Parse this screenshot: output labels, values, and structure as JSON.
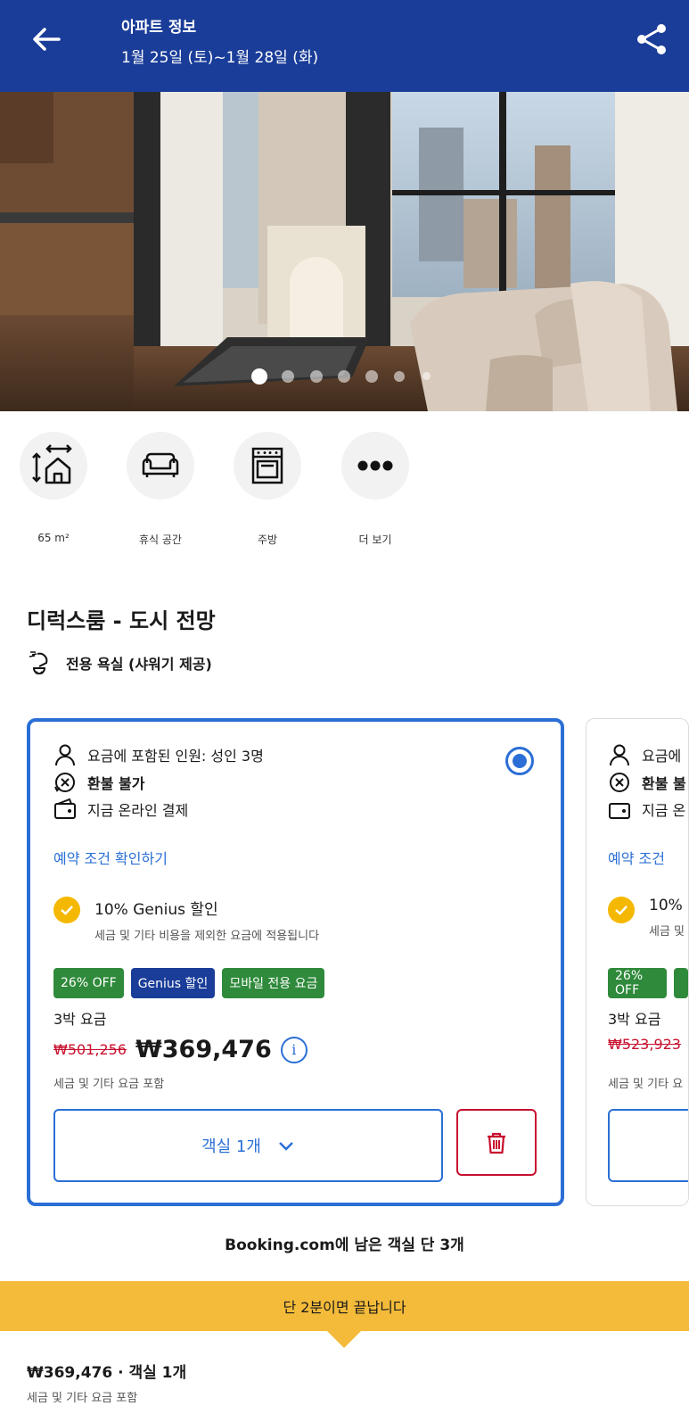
{
  "header": {
    "title": "아파트 정보",
    "dates": "1월 25일 (토)~1월 28일 (화)",
    "back_icon": "arrow-left-icon",
    "share_icon": "share-icon",
    "bg_color": "#1a3d99"
  },
  "photo": {
    "description_icon": "room-photo",
    "dots_count": 7,
    "active_index": 0
  },
  "amenities": [
    {
      "icon": "area-icon",
      "label": "65 m²"
    },
    {
      "icon": "sofa-icon",
      "label": "휴식 공간"
    },
    {
      "icon": "oven-icon",
      "label": "주방"
    },
    {
      "icon": "more-icon",
      "label": "더 보기"
    }
  ],
  "room": {
    "title": "디럭스룸 - 도시 전망",
    "bathroom": "전용 욕실 (샤워기 제공)"
  },
  "card_main": {
    "guests": "요금에 포함된 인원: 성인 3명",
    "refund": "환불 불가",
    "payment": "지금 온라인 결제",
    "conditions_link": "예약 조건 확인하기",
    "genius_title": "10% Genius 할인",
    "genius_sub": "세금 및 기타 비용을 제외한 요금에 적용됩니다",
    "badge_off": "26% OFF",
    "badge_genius": "Genius 할인",
    "badge_mobile": "모바일 전용 요금",
    "nights": "3박 요금",
    "old_price": "₩501,256",
    "new_price": "₩369,476",
    "info_icon": "i",
    "tax_note": "세금 및 기타 요금 포함",
    "rooms_select": "객실 1개",
    "selected": true
  },
  "card_next": {
    "guests": "요금에",
    "refund": "환불 불",
    "payment": "지금 온",
    "conditions_link": "예약 조건",
    "genius_title": "10% (",
    "genius_sub": "세금 및",
    "badge_off": "26% OFF",
    "nights": "3박 요금",
    "old_price": "₩523,923",
    "tax_note": "세금 및 기타 요"
  },
  "availability": "Booking.com에 남은 객실 단 3개",
  "banner": "단 2분이면 끝납니다",
  "total": {
    "summary": "₩369,476 · 객실 1개",
    "tax_note": "세금 및 기타 요금 포함"
  },
  "colors": {
    "accent": "#2b6fd6",
    "header": "#1a3d99",
    "discount_red": "#c8102e",
    "badge_green": "#2f8a3b",
    "banner_yellow": "#f4bb3a"
  }
}
